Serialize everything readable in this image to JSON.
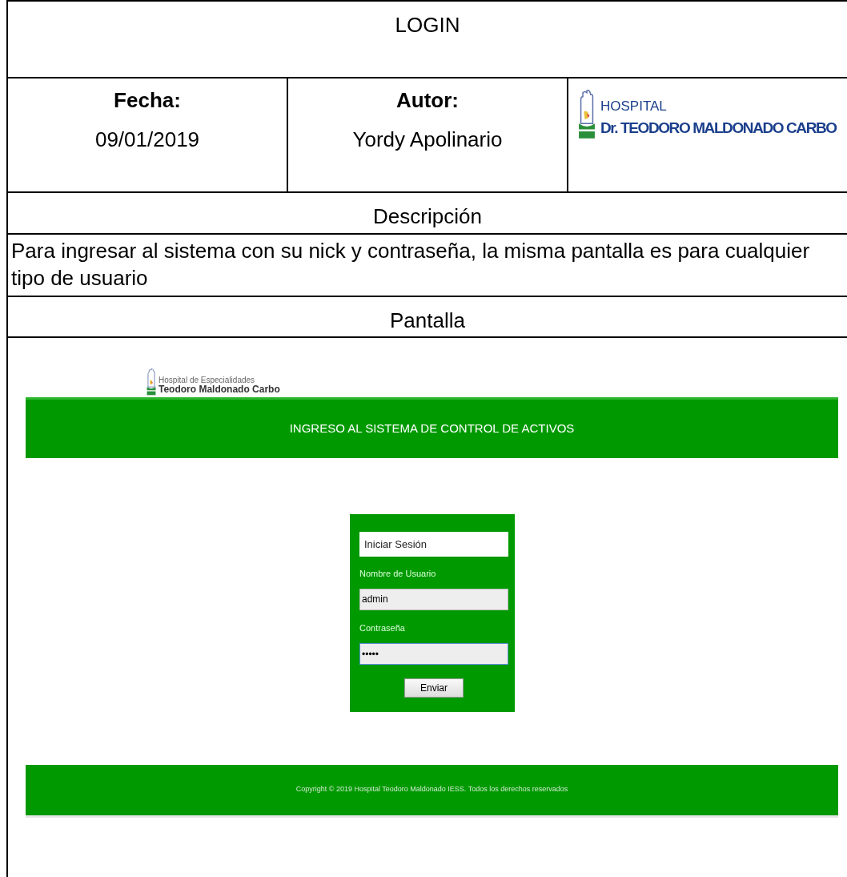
{
  "title": "LOGIN",
  "info": [
    {
      "label": "Fecha:",
      "value": "09/01/2019"
    },
    {
      "label": "Autor:",
      "value": "Yordy Apolinario"
    }
  ],
  "logo": {
    "line_1": "HOSPITAL",
    "line_2": "Dr. TEODORO MALDONADO CARBO"
  },
  "description_heading": "Descripción",
  "description": "Para ingresar al sistema con su nick y contraseña, la misma pantalla es para cualquier tipo de usuario",
  "screen_heading": "Pantalla",
  "screen": {
    "logo": {
      "line_1": "Hospital de Especialidades",
      "line_2": "Teodoro Maldonado Carbo"
    },
    "banner": "INGRESO AL SISTEMA DE CONTROL DE ACTIVOS",
    "login": {
      "title": "Iniciar Sesión",
      "fields": [
        {
          "label": "Nombre de Usuario",
          "value": "admin",
          "focused": false
        },
        {
          "label": "Contraseña",
          "value": "•••••",
          "focused": true
        }
      ],
      "button": "Enviar"
    },
    "footer": "Copyright © 2019 Hospital Teodoro Maldonado IESS. Todos los derechos reservados"
  }
}
